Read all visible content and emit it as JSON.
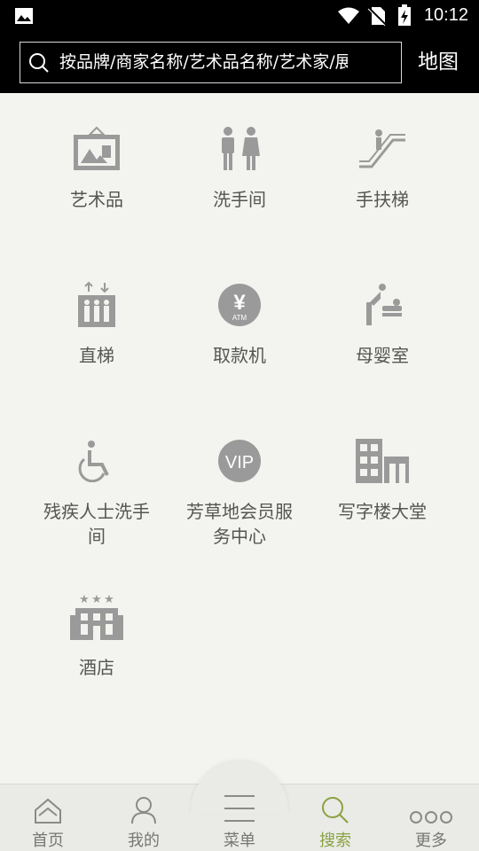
{
  "status_bar": {
    "time": "10:12"
  },
  "search": {
    "placeholder": "按品牌/商家名称/艺术品名称/艺术家/展",
    "map_label": "地图"
  },
  "categories": [
    {
      "label": "艺术品",
      "icon": "artwork-icon"
    },
    {
      "label": "洗手间",
      "icon": "restroom-icon"
    },
    {
      "label": "手扶梯",
      "icon": "escalator-icon"
    },
    {
      "label": "直梯",
      "icon": "elevator-icon"
    },
    {
      "label": "取款机",
      "icon": "atm-icon"
    },
    {
      "label": "母婴室",
      "icon": "baby-care-icon"
    },
    {
      "label": "残疾人士洗手间",
      "icon": "accessible-icon"
    },
    {
      "label": "芳草地会员服务中心",
      "icon": "vip-icon"
    },
    {
      "label": "写字楼大堂",
      "icon": "office-building-icon"
    },
    {
      "label": "酒店",
      "icon": "hotel-icon"
    }
  ],
  "tabs": [
    {
      "label": "首页",
      "icon": "home-icon"
    },
    {
      "label": "我的",
      "icon": "user-icon"
    },
    {
      "label": "菜单",
      "icon": "menu-icon"
    },
    {
      "label": "搜索",
      "icon": "search-icon",
      "active": true
    },
    {
      "label": "更多",
      "icon": "more-icon"
    }
  ],
  "colors": {
    "accent": "#8aa242",
    "icon_gray": "#9a9a9a",
    "background": "#f3f3ef",
    "header": "#000000"
  }
}
